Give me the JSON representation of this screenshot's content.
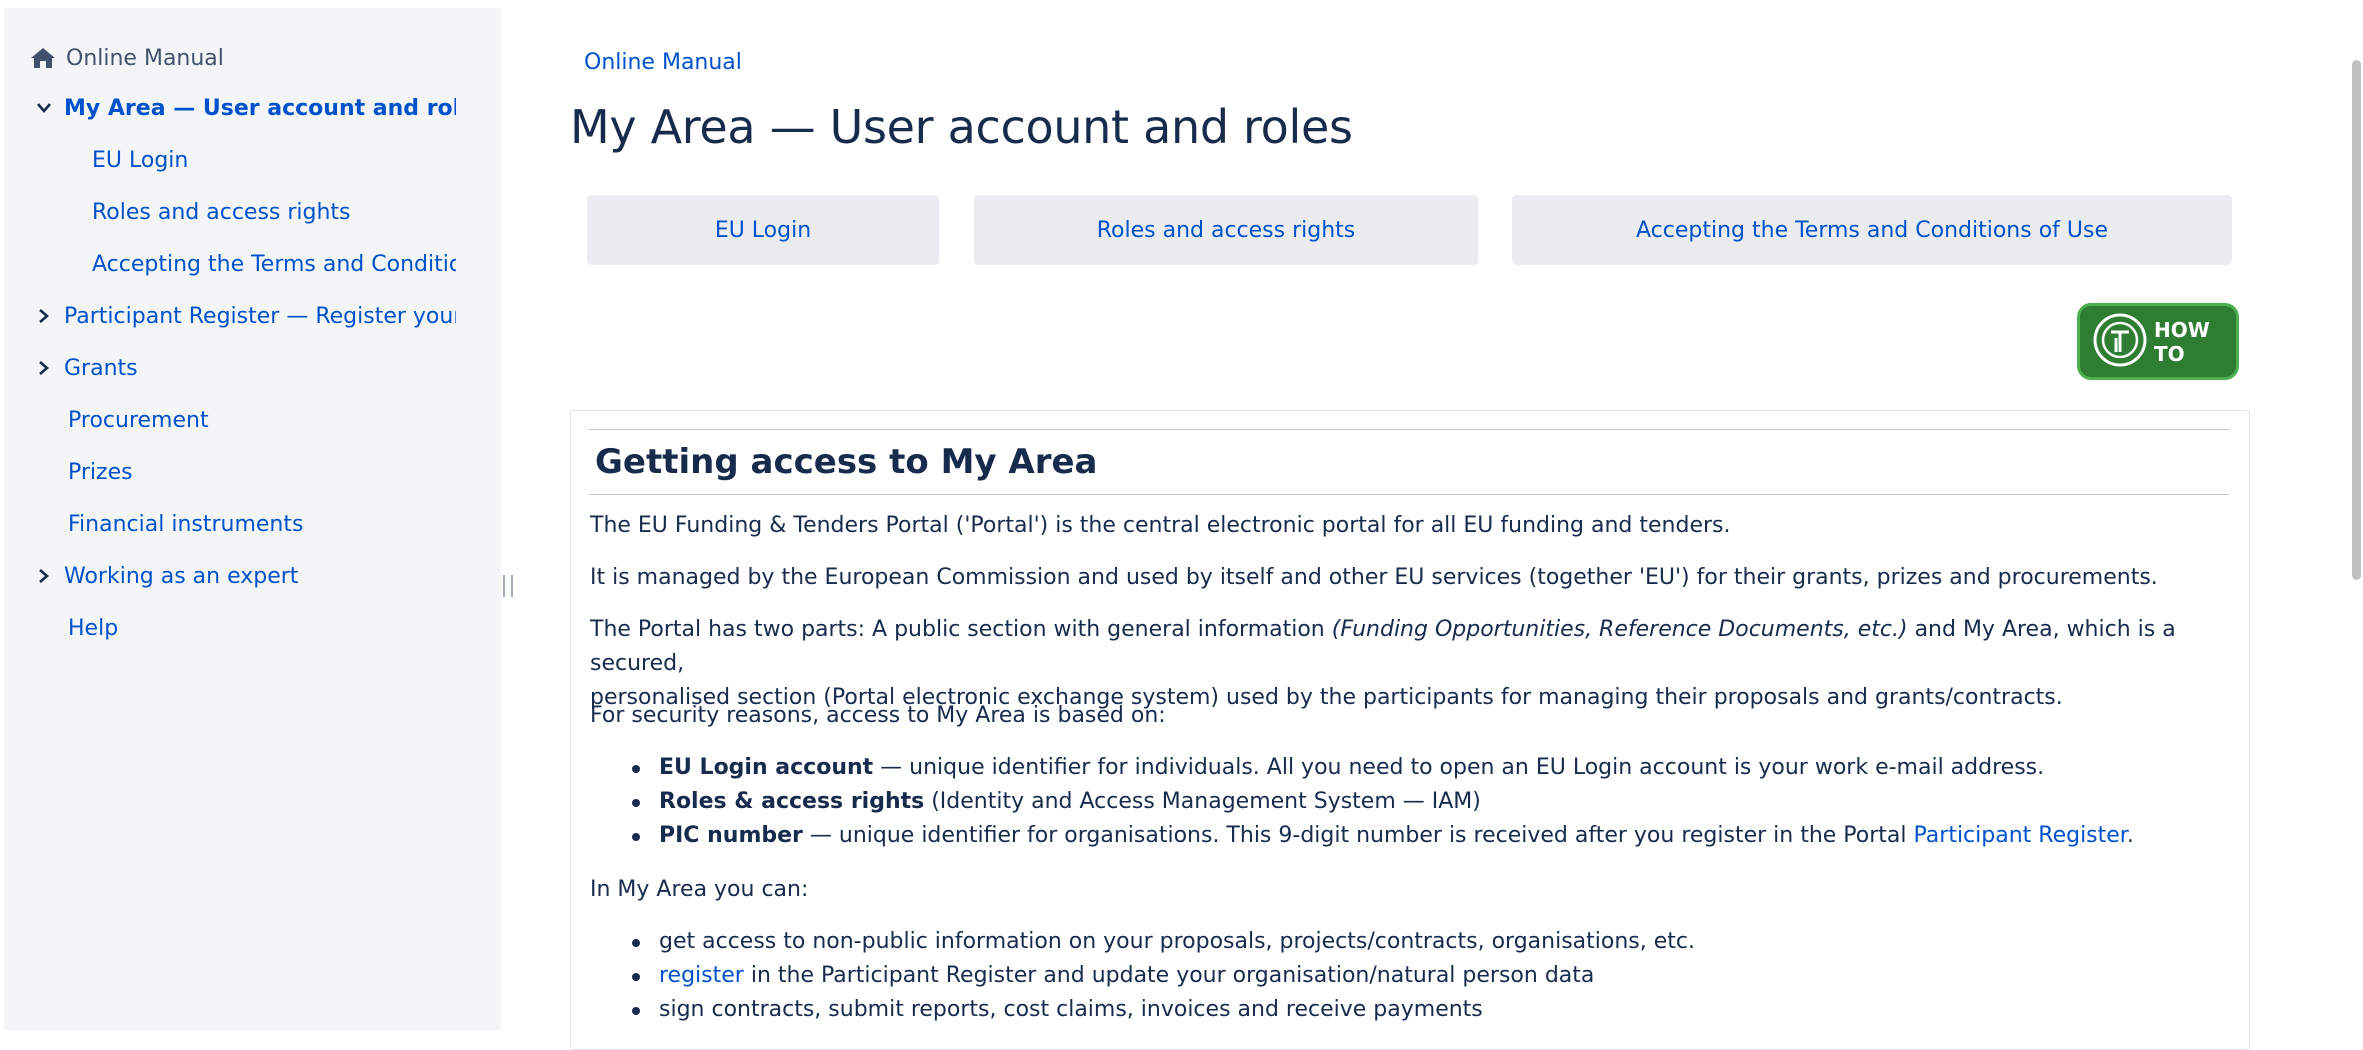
{
  "sidebar": {
    "items": [
      {
        "label": "Online Manual"
      },
      {
        "label": "My Area — User account and roles"
      },
      {
        "label": "EU Login"
      },
      {
        "label": "Roles and access rights"
      },
      {
        "label": "Accepting the Terms and Conditions of Use"
      },
      {
        "label": "Participant Register — Register your organisation"
      },
      {
        "label": "Grants"
      },
      {
        "label": "Procurement"
      },
      {
        "label": "Prizes"
      },
      {
        "label": "Financial instruments"
      },
      {
        "label": "Working as an expert"
      },
      {
        "label": "Help"
      }
    ]
  },
  "main": {
    "breadcrumb": "Online Manual",
    "title": "My Area — User account and roles",
    "tabs": [
      {
        "label": "EU Login"
      },
      {
        "label": "Roles and access rights"
      },
      {
        "label": "Accepting the Terms and Conditions of Use"
      }
    ],
    "howto_label": "HOW TO",
    "section": {
      "heading": "Getting access to My Area",
      "p1": "The EU Funding & Tenders Portal ('Portal') is the central electronic portal for all EU funding and tenders.",
      "p2": "It is managed by the European Commission and used by itself and other EU services (together 'EU') for their grants, prizes and procurements.",
      "p3_before": "The Portal has two parts: A public section with general information ",
      "p3_italic": "(Funding Opportunities, Reference Documents, etc.)",
      "p3_after_line1": " and My Area, which is a secured,",
      "p3_line2": "personalised section (Portal electronic exchange system) used by the participants for managing their proposals and grants/contracts.",
      "p4": "For security reasons, access to My Area is based on:",
      "access": [
        {
          "bold": "EU Login account",
          "text": " — unique identifier for individuals. All you need to open an EU Login account is your work e-mail address."
        },
        {
          "bold": "Roles & access rights",
          "text": " (Identity and Access Management System — IAM)"
        },
        {
          "bold": "PIC number",
          "text": " — unique identifier for organisations. This 9-digit number is received after you register in the Portal ",
          "link": "Participant Register",
          "after": "."
        }
      ],
      "p5": "In My Area you can:",
      "can": [
        {
          "text": "get access to non-public information on your proposals, projects/contracts, organisations, etc."
        },
        {
          "link": "register",
          "text": " in the Participant Register and update your organisation/natural person data"
        },
        {
          "text": "sign contracts, submit reports, cost claims, invoices and receive payments"
        }
      ]
    }
  },
  "colors": {
    "link": "#0052cc",
    "text": "#172b4d",
    "sidebar_bg": "#f4f5f7",
    "tab_bg": "#ebecf0",
    "howto_bg": "#2e7d32"
  },
  "icons": {
    "home": "home-icon",
    "expand": "chevron-down-icon",
    "collapse": "chevron-right-icon",
    "howto": "howto-logo-icon"
  }
}
